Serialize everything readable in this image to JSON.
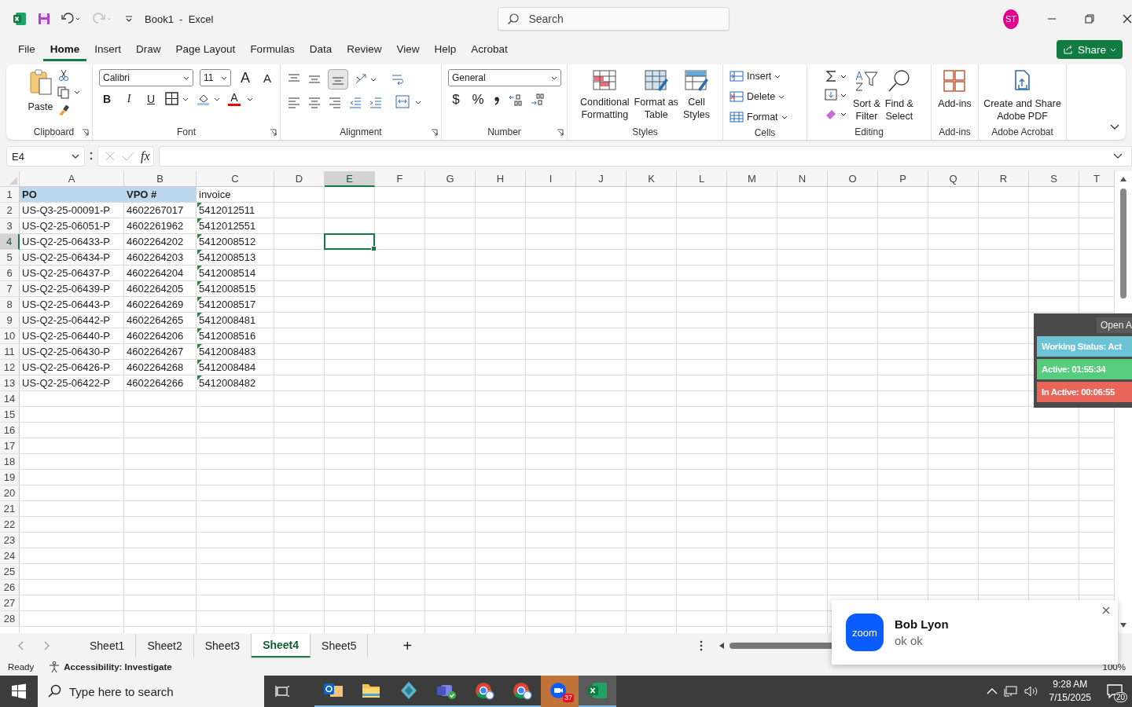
{
  "title_bar": {
    "title": "Book1  -  Excel",
    "search_placeholder": "Search",
    "avatar": "ST"
  },
  "menu_tabs": [
    {
      "label": "File",
      "selected": false
    },
    {
      "label": "Home",
      "selected": true
    },
    {
      "label": "Insert",
      "selected": false
    },
    {
      "label": "Draw",
      "selected": false
    },
    {
      "label": "Page Layout",
      "selected": false
    },
    {
      "label": "Formulas",
      "selected": false
    },
    {
      "label": "Data",
      "selected": false
    },
    {
      "label": "Review",
      "selected": false
    },
    {
      "label": "View",
      "selected": false
    },
    {
      "label": "Help",
      "selected": false
    },
    {
      "label": "Acrobat",
      "selected": false
    }
  ],
  "share_button": "Share",
  "ribbon": {
    "clipboard": {
      "label": "Clipboard",
      "paste": "Paste"
    },
    "font": {
      "label": "Font",
      "family": "Calibri",
      "size": "11",
      "grow": "A",
      "shrink": "A",
      "styles": [
        "B",
        "I",
        "U"
      ],
      "color_letter": "A"
    },
    "alignment": {
      "label": "Alignment"
    },
    "number": {
      "label": "Number",
      "format": "General",
      "symbols": [
        "$",
        "%"
      ]
    },
    "styles": {
      "label": "Styles",
      "buttons": [
        {
          "kind": "conditional",
          "lines": [
            "Conditional",
            "Formatting"
          ]
        },
        {
          "kind": "table",
          "lines": [
            "Format as",
            "Table"
          ]
        },
        {
          "kind": "cellstyle",
          "lines": [
            "Cell",
            "Styles"
          ]
        }
      ]
    },
    "cells": {
      "label": "Cells",
      "buttons": [
        {
          "kind": "insert",
          "label": "Insert"
        },
        {
          "kind": "delete",
          "label": "Delete"
        },
        {
          "kind": "format",
          "label": "Format"
        }
      ]
    },
    "editing": {
      "label": "Editing",
      "buttons": [
        {
          "kind": "sort",
          "lines": [
            "Sort &",
            "Filter"
          ]
        },
        {
          "kind": "find",
          "lines": [
            "Find &",
            "Select"
          ]
        }
      ]
    },
    "addins": {
      "label": "Add-ins",
      "buttons": [
        {
          "kind": "addins",
          "lines": [
            "Add-ins"
          ]
        }
      ]
    },
    "acrobat": {
      "label": "Adobe Acrobat",
      "buttons": [
        {
          "kind": "pdf",
          "lines": [
            "Create and Share",
            "Adobe PDF"
          ]
        }
      ]
    }
  },
  "formula_bar": {
    "name_box": "E4",
    "function_symbol": "fx"
  },
  "sheet": {
    "columns": [
      {
        "label": "A",
        "selected": false
      },
      {
        "label": "B",
        "selected": false
      },
      {
        "label": "C",
        "selected": false
      },
      {
        "label": "D",
        "selected": false
      },
      {
        "label": "E",
        "selected": true
      },
      {
        "label": "F",
        "selected": false
      },
      {
        "label": "G",
        "selected": false
      },
      {
        "label": "H",
        "selected": false
      },
      {
        "label": "I",
        "selected": false
      },
      {
        "label": "J",
        "selected": false
      },
      {
        "label": "K",
        "selected": false
      },
      {
        "label": "L",
        "selected": false
      },
      {
        "label": "M",
        "selected": false
      },
      {
        "label": "N",
        "selected": false
      },
      {
        "label": "O",
        "selected": false
      },
      {
        "label": "P",
        "selected": false
      },
      {
        "label": "Q",
        "selected": false
      },
      {
        "label": "R",
        "selected": false
      },
      {
        "label": "S",
        "selected": false
      },
      {
        "label": "T",
        "selected": false
      }
    ],
    "rows": [
      {
        "label": "1",
        "selected": false,
        "cells": [
          {
            "text": "PO",
            "highlighted": true,
            "flagged": false
          },
          {
            "text": "VPO #",
            "highlighted": true,
            "flagged": false
          },
          {
            "text": "invoice",
            "highlighted": false,
            "flagged": false
          }
        ]
      },
      {
        "label": "2",
        "selected": false,
        "cells": [
          {
            "text": "US-Q3-25-00091-P",
            "highlighted": false,
            "flagged": false
          },
          {
            "text": "4602267017",
            "highlighted": false,
            "flagged": false
          },
          {
            "text": "5412012511",
            "highlighted": false,
            "flagged": true
          }
        ]
      },
      {
        "label": "3",
        "selected": false,
        "cells": [
          {
            "text": "US-Q2-25-06051-P",
            "highlighted": false,
            "flagged": false
          },
          {
            "text": "4602261962",
            "highlighted": false,
            "flagged": false
          },
          {
            "text": "5412012551",
            "highlighted": false,
            "flagged": true
          }
        ]
      },
      {
        "label": "4",
        "selected": true,
        "cells": [
          {
            "text": "US-Q2-25-06433-P",
            "highlighted": false,
            "flagged": false
          },
          {
            "text": "4602264202",
            "highlighted": false,
            "flagged": false
          },
          {
            "text": "5412008512",
            "highlighted": false,
            "flagged": true
          }
        ]
      },
      {
        "label": "5",
        "selected": false,
        "cells": [
          {
            "text": "US-Q2-25-06434-P",
            "highlighted": false,
            "flagged": false
          },
          {
            "text": "4602264203",
            "highlighted": false,
            "flagged": false
          },
          {
            "text": "5412008513",
            "highlighted": false,
            "flagged": true
          }
        ]
      },
      {
        "label": "6",
        "selected": false,
        "cells": [
          {
            "text": "US-Q2-25-06437-P",
            "highlighted": false,
            "flagged": false
          },
          {
            "text": "4602264204",
            "highlighted": false,
            "flagged": false
          },
          {
            "text": "5412008514",
            "highlighted": false,
            "flagged": true
          }
        ]
      },
      {
        "label": "7",
        "selected": false,
        "cells": [
          {
            "text": "US-Q2-25-06439-P",
            "highlighted": false,
            "flagged": false
          },
          {
            "text": "4602264205",
            "highlighted": false,
            "flagged": false
          },
          {
            "text": "5412008515",
            "highlighted": false,
            "flagged": true
          }
        ]
      },
      {
        "label": "8",
        "selected": false,
        "cells": [
          {
            "text": "US-Q2-25-06443-P",
            "highlighted": false,
            "flagged": false
          },
          {
            "text": "4602264269",
            "highlighted": false,
            "flagged": false
          },
          {
            "text": "5412008517",
            "highlighted": false,
            "flagged": true
          }
        ]
      },
      {
        "label": "9",
        "selected": false,
        "cells": [
          {
            "text": "US-Q2-25-06442-P",
            "highlighted": false,
            "flagged": false
          },
          {
            "text": "4602264265",
            "highlighted": false,
            "flagged": false
          },
          {
            "text": "5412008481",
            "highlighted": false,
            "flagged": true
          }
        ]
      },
      {
        "label": "10",
        "selected": false,
        "cells": [
          {
            "text": "US-Q2-25-06440-P",
            "highlighted": false,
            "flagged": false
          },
          {
            "text": "4602264206",
            "highlighted": false,
            "flagged": false
          },
          {
            "text": "5412008516",
            "highlighted": false,
            "flagged": true
          }
        ]
      },
      {
        "label": "11",
        "selected": false,
        "cells": [
          {
            "text": "US-Q2-25-06430-P",
            "highlighted": false,
            "flagged": false
          },
          {
            "text": "4602264267",
            "highlighted": false,
            "flagged": false
          },
          {
            "text": "5412008483",
            "highlighted": false,
            "flagged": true
          }
        ]
      },
      {
        "label": "12",
        "selected": false,
        "cells": [
          {
            "text": "US-Q2-25-06426-P",
            "highlighted": false,
            "flagged": false
          },
          {
            "text": "4602264268",
            "highlighted": false,
            "flagged": false
          },
          {
            "text": "5412008484",
            "highlighted": false,
            "flagged": true
          }
        ]
      },
      {
        "label": "13",
        "selected": false,
        "cells": [
          {
            "text": "US-Q2-25-06422-P",
            "highlighted": false,
            "flagged": false
          },
          {
            "text": "4602264266",
            "highlighted": false,
            "flagged": false
          },
          {
            "text": "5412008482",
            "highlighted": false,
            "flagged": true
          }
        ]
      },
      {
        "label": "14",
        "selected": false
      },
      {
        "label": "15",
        "selected": false
      },
      {
        "label": "16",
        "selected": false
      },
      {
        "label": "17",
        "selected": false
      },
      {
        "label": "18",
        "selected": false
      },
      {
        "label": "19",
        "selected": false
      },
      {
        "label": "20",
        "selected": false
      },
      {
        "label": "21",
        "selected": false
      },
      {
        "label": "22",
        "selected": false
      },
      {
        "label": "23",
        "selected": false
      },
      {
        "label": "24",
        "selected": false
      },
      {
        "label": "25",
        "selected": false
      },
      {
        "label": "26",
        "selected": false
      },
      {
        "label": "27",
        "selected": false
      },
      {
        "label": "28",
        "selected": false
      }
    ]
  },
  "status_widget": {
    "button": "Open A",
    "items": [
      {
        "text": "Working Status: Act",
        "color": "#6cc3d5"
      },
      {
        "text": "Active: 01:55:34",
        "color": "#56cc7d"
      },
      {
        "text": "In Active: 00:06:55",
        "color": "#e8675a"
      }
    ]
  },
  "notification": {
    "app_logo": "zoom",
    "sender": "Bob Lyon",
    "message": "ok ok"
  },
  "sheet_tabs": [
    {
      "label": "Sheet1",
      "selected": false
    },
    {
      "label": "Sheet2",
      "selected": false
    },
    {
      "label": "Sheet3",
      "selected": false
    },
    {
      "label": "Sheet4",
      "selected": true
    },
    {
      "label": "Sheet5",
      "selected": false
    }
  ],
  "add_sheet": "+",
  "status_bar": {
    "mode": "Ready",
    "accessibility": "Accessibility: Investigate",
    "zoom": "100%"
  },
  "taskbar": {
    "search_placeholder": "Type here to search",
    "apps": [
      {
        "kind": "mail",
        "running": true,
        "flashing": false,
        "selected": false
      },
      {
        "kind": "folder",
        "running": true,
        "flashing": false,
        "selected": false
      },
      {
        "kind": "diamond",
        "running": true,
        "flashing": false,
        "selected": false
      },
      {
        "kind": "teams",
        "running": true,
        "flashing": false,
        "selected": false
      },
      {
        "kind": "chrome",
        "running": true,
        "flashing": false,
        "selected": false
      },
      {
        "kind": "chrome",
        "running": true,
        "flashing": false,
        "selected": false
      },
      {
        "kind": "zoom",
        "running": false,
        "flashing": true,
        "selected": false,
        "badge": "37"
      },
      {
        "kind": "excel",
        "running": true,
        "flashing": false,
        "selected": true
      }
    ],
    "time": "9:28 AM",
    "date": "7/15/2025",
    "notification_count": "20"
  }
}
